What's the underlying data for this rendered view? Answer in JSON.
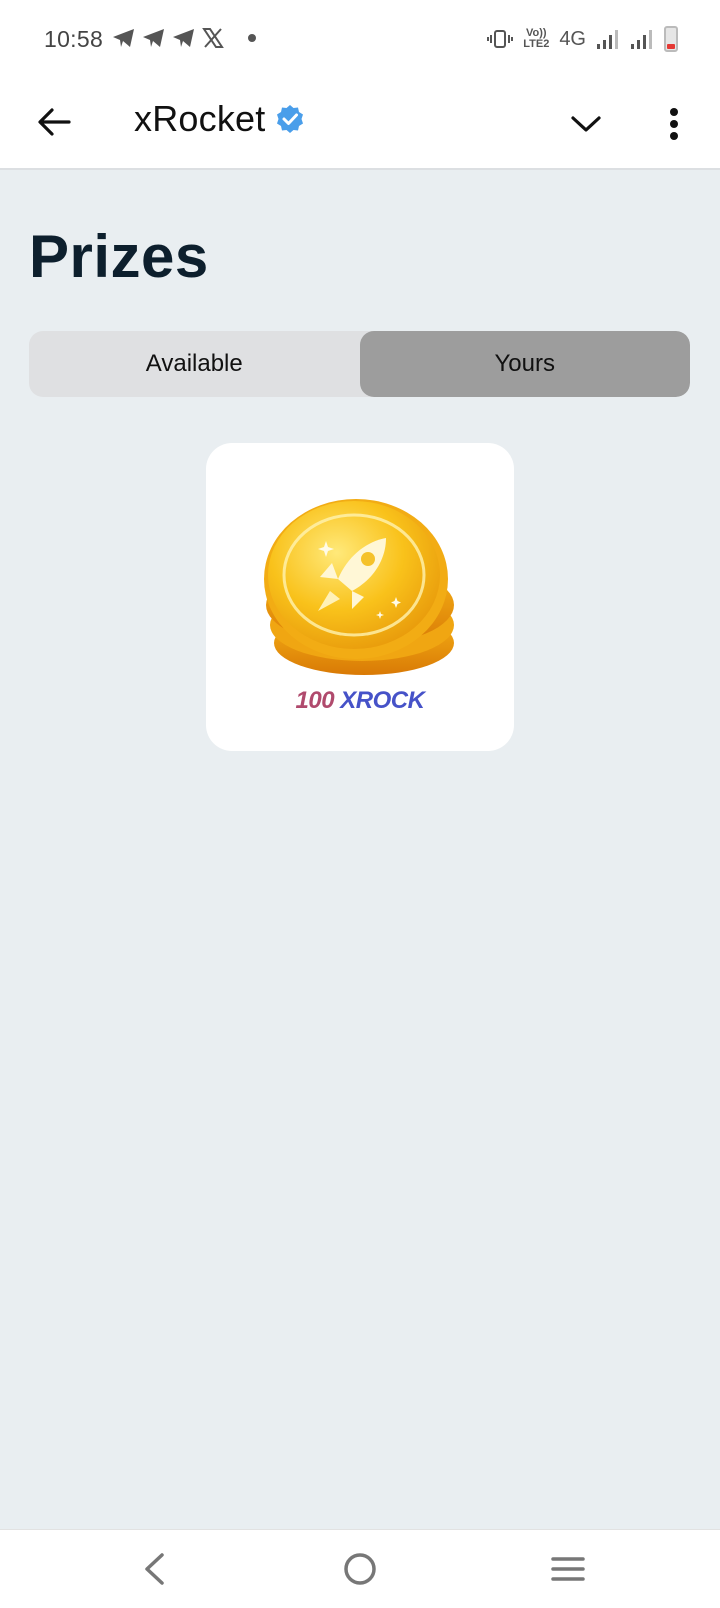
{
  "status_bar": {
    "time": "10:58",
    "notification_icons": [
      "telegram-icon",
      "telegram-icon",
      "telegram-icon",
      "x-icon"
    ],
    "volte_label_line1": "Vo))",
    "volte_label_line2": "LTE2",
    "network_type": "4G"
  },
  "header": {
    "title": "xRocket",
    "verified": true,
    "accent_color": "#4a9eea"
  },
  "page": {
    "title": "Prizes"
  },
  "tabs": [
    {
      "label": "Available",
      "active": false
    },
    {
      "label": "Yours",
      "active": true
    }
  ],
  "prizes": [
    {
      "amount": "100",
      "unit": "XROCK",
      "icon": "xrock-coin-icon"
    }
  ],
  "colors": {
    "background": "#e9eef1",
    "title": "#0d1f2d",
    "active_tab": "#9d9d9d",
    "inactive_tab": "#dfe0e2",
    "battery_low": "#e53935"
  }
}
